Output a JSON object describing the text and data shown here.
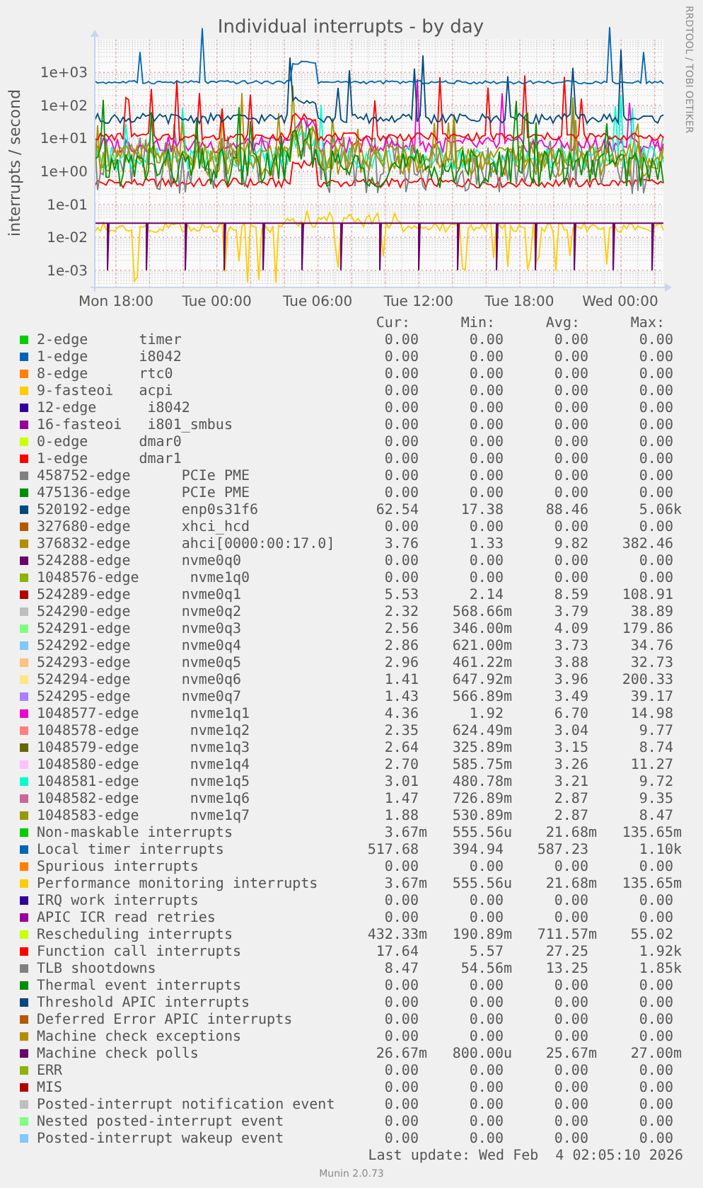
{
  "graph": {
    "title": "Individual interrupts - by day",
    "y_axis_label": "interrupts / second",
    "credit": "RRDTOOL / TOBI OETIKER",
    "y_ticks": [
      "1e+03",
      "1e+02",
      "1e+01",
      "1e+00",
      "1e-01",
      "1e-02",
      "1e-03"
    ],
    "x_ticks": [
      "Mon 18:00",
      "Tue 00:00",
      "Tue 06:00",
      "Tue 12:00",
      "Tue 18:00",
      "Wed 00:00"
    ]
  },
  "legend": {
    "columns": [
      "Cur:",
      "Min:",
      "Avg:",
      "Max:"
    ],
    "rows": [
      {
        "label": "2-edge      timer",
        "color": "#00cc00",
        "cur": "0.00",
        "min": "0.00",
        "avg": "0.00",
        "max": "0.00"
      },
      {
        "label": "1-edge      i8042",
        "color": "#0066b3",
        "cur": "0.00",
        "min": "0.00",
        "avg": "0.00",
        "max": "0.00"
      },
      {
        "label": "8-edge      rtc0",
        "color": "#ff8000",
        "cur": "0.00",
        "min": "0.00",
        "avg": "0.00",
        "max": "0.00"
      },
      {
        "label": "9-fasteoi   acpi",
        "color": "#ffcc00",
        "cur": "0.00",
        "min": "0.00",
        "avg": "0.00",
        "max": "0.00"
      },
      {
        "label": "12-edge      i8042",
        "color": "#330099",
        "cur": "0.00",
        "min": "0.00",
        "avg": "0.00",
        "max": "0.00"
      },
      {
        "label": "16-fasteoi   i801_smbus",
        "color": "#990099",
        "cur": "0.00",
        "min": "0.00",
        "avg": "0.00",
        "max": "0.00"
      },
      {
        "label": "0-edge      dmar0",
        "color": "#ccff00",
        "cur": "0.00",
        "min": "0.00",
        "avg": "0.00",
        "max": "0.00"
      },
      {
        "label": "1-edge      dmar1",
        "color": "#ff0000",
        "cur": "0.00",
        "min": "0.00",
        "avg": "0.00",
        "max": "0.00"
      },
      {
        "label": "458752-edge      PCIe PME",
        "color": "#808080",
        "cur": "0.00",
        "min": "0.00",
        "avg": "0.00",
        "max": "0.00"
      },
      {
        "label": "475136-edge      PCIe PME",
        "color": "#008f00",
        "cur": "0.00",
        "min": "0.00",
        "avg": "0.00",
        "max": "0.00"
      },
      {
        "label": "520192-edge      enp0s31f6",
        "color": "#00487d",
        "cur": "62.54",
        "min": "17.38",
        "avg": "88.46",
        "max": "5.06k"
      },
      {
        "label": "327680-edge      xhci_hcd",
        "color": "#b35a00",
        "cur": "0.00",
        "min": "0.00",
        "avg": "0.00",
        "max": "0.00"
      },
      {
        "label": "376832-edge      ahci[0000:00:17.0]",
        "color": "#b38f00",
        "cur": "3.76",
        "min": "1.33",
        "avg": "9.82",
        "max": "382.46"
      },
      {
        "label": "524288-edge      nvme0q0",
        "color": "#6b006b",
        "cur": "0.00",
        "min": "0.00",
        "avg": "0.00",
        "max": "0.00"
      },
      {
        "label": "1048576-edge      nvme1q0",
        "color": "#8fb300",
        "cur": "0.00",
        "min": "0.00",
        "avg": "0.00",
        "max": "0.00"
      },
      {
        "label": "524289-edge      nvme0q1",
        "color": "#b30000",
        "cur": "5.53",
        "min": "2.14",
        "avg": "8.59",
        "max": "108.91"
      },
      {
        "label": "524290-edge      nvme0q2",
        "color": "#bebebe",
        "cur": "2.32",
        "min": "568.66m",
        "avg": "3.79",
        "max": "38.89"
      },
      {
        "label": "524291-edge      nvme0q3",
        "color": "#80ff80",
        "cur": "2.56",
        "min": "346.00m",
        "avg": "4.09",
        "max": "179.86"
      },
      {
        "label": "524292-edge      nvme0q4",
        "color": "#80c9ff",
        "cur": "2.86",
        "min": "621.00m",
        "avg": "3.73",
        "max": "34.76"
      },
      {
        "label": "524293-edge      nvme0q5",
        "color": "#ffc080",
        "cur": "2.96",
        "min": "461.22m",
        "avg": "3.88",
        "max": "32.73"
      },
      {
        "label": "524294-edge      nvme0q6",
        "color": "#ffe680",
        "cur": "1.41",
        "min": "647.92m",
        "avg": "3.96",
        "max": "200.33"
      },
      {
        "label": "524295-edge      nvme0q7",
        "color": "#aa80ff",
        "cur": "1.43",
        "min": "566.89m",
        "avg": "3.49",
        "max": "39.17"
      },
      {
        "label": "1048577-edge      nvme1q1",
        "color": "#ee00cc",
        "cur": "4.36",
        "min": "1.92",
        "avg": "6.70",
        "max": "14.98"
      },
      {
        "label": "1048578-edge      nvme1q2",
        "color": "#ff8080",
        "cur": "2.35",
        "min": "624.49m",
        "avg": "3.04",
        "max": "9.77"
      },
      {
        "label": "1048579-edge      nvme1q3",
        "color": "#666600",
        "cur": "2.64",
        "min": "325.89m",
        "avg": "3.15",
        "max": "8.74"
      },
      {
        "label": "1048580-edge      nvme1q4",
        "color": "#ffbfff",
        "cur": "2.70",
        "min": "585.75m",
        "avg": "3.26",
        "max": "11.27"
      },
      {
        "label": "1048581-edge      nvme1q5",
        "color": "#00ffcc",
        "cur": "3.01",
        "min": "480.78m",
        "avg": "3.21",
        "max": "9.72"
      },
      {
        "label": "1048582-edge      nvme1q6",
        "color": "#cc6699",
        "cur": "1.47",
        "min": "726.89m",
        "avg": "2.87",
        "max": "9.35"
      },
      {
        "label": "1048583-edge      nvme1q7",
        "color": "#999900",
        "cur": "1.88",
        "min": "530.89m",
        "avg": "2.87",
        "max": "8.47"
      },
      {
        "label": "Non-maskable interrupts",
        "color": "#00cc00",
        "cur": "3.67m",
        "min": "555.56u",
        "avg": "21.68m",
        "max": "135.65m"
      },
      {
        "label": "Local timer interrupts",
        "color": "#0066b3",
        "cur": "517.68",
        "min": "394.94",
        "avg": "587.23",
        "max": "1.10k"
      },
      {
        "label": "Spurious interrupts",
        "color": "#ff8000",
        "cur": "0.00",
        "min": "0.00",
        "avg": "0.00",
        "max": "0.00"
      },
      {
        "label": "Performance monitoring interrupts",
        "color": "#ffcc00",
        "cur": "3.67m",
        "min": "555.56u",
        "avg": "21.68m",
        "max": "135.65m"
      },
      {
        "label": "IRQ work interrupts",
        "color": "#330099",
        "cur": "0.00",
        "min": "0.00",
        "avg": "0.00",
        "max": "0.00"
      },
      {
        "label": "APIC ICR read retries",
        "color": "#990099",
        "cur": "0.00",
        "min": "0.00",
        "avg": "0.00",
        "max": "0.00"
      },
      {
        "label": "Rescheduling interrupts",
        "color": "#ccff00",
        "cur": "432.33m",
        "min": "190.89m",
        "avg": "711.57m",
        "max": "55.02"
      },
      {
        "label": "Function call interrupts",
        "color": "#ff0000",
        "cur": "17.64",
        "min": "5.57",
        "avg": "27.25",
        "max": "1.92k"
      },
      {
        "label": "TLB shootdowns",
        "color": "#808080",
        "cur": "8.47",
        "min": "54.56m",
        "avg": "13.25",
        "max": "1.85k"
      },
      {
        "label": "Thermal event interrupts",
        "color": "#008f00",
        "cur": "0.00",
        "min": "0.00",
        "avg": "0.00",
        "max": "0.00"
      },
      {
        "label": "Threshold APIC interrupts",
        "color": "#00487d",
        "cur": "0.00",
        "min": "0.00",
        "avg": "0.00",
        "max": "0.00"
      },
      {
        "label": "Deferred Error APIC interrupts",
        "color": "#b35a00",
        "cur": "0.00",
        "min": "0.00",
        "avg": "0.00",
        "max": "0.00"
      },
      {
        "label": "Machine check exceptions",
        "color": "#b38f00",
        "cur": "0.00",
        "min": "0.00",
        "avg": "0.00",
        "max": "0.00"
      },
      {
        "label": "Machine check polls",
        "color": "#6b006b",
        "cur": "26.67m",
        "min": "800.00u",
        "avg": "25.67m",
        "max": "27.00m"
      },
      {
        "label": "ERR",
        "color": "#8fb300",
        "cur": "0.00",
        "min": "0.00",
        "avg": "0.00",
        "max": "0.00"
      },
      {
        "label": "MIS",
        "color": "#b30000",
        "cur": "0.00",
        "min": "0.00",
        "avg": "0.00",
        "max": "0.00"
      },
      {
        "label": "Posted-interrupt notification event",
        "color": "#bebebe",
        "cur": "0.00",
        "min": "0.00",
        "avg": "0.00",
        "max": "0.00"
      },
      {
        "label": "Nested posted-interrupt event",
        "color": "#80ff80",
        "cur": "0.00",
        "min": "0.00",
        "avg": "0.00",
        "max": "0.00"
      },
      {
        "label": "Posted-interrupt wakeup event",
        "color": "#80c9ff",
        "cur": "0.00",
        "min": "0.00",
        "avg": "0.00",
        "max": "0.00"
      }
    ]
  },
  "last_update": "Last update: Wed Feb  4 02:05:10 2026",
  "footer": "Munin 2.0.73"
}
